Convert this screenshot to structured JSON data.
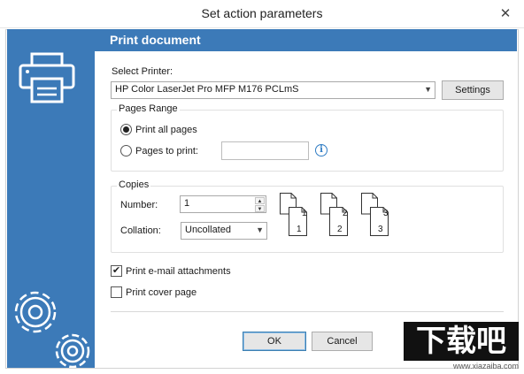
{
  "window": {
    "title": "Set action parameters",
    "close_glyph": "✕"
  },
  "header": {
    "title": "Print document"
  },
  "printer": {
    "label": "Select Printer:",
    "selected": "HP Color LaserJet Pro MFP M176 PCLmS",
    "settings_label": "Settings"
  },
  "pages_range": {
    "legend": "Pages Range",
    "print_all_label": "Print all pages",
    "print_all_selected": true,
    "pages_to_print_label": "Pages to print:",
    "pages_value": ""
  },
  "copies": {
    "legend": "Copies",
    "number_label": "Number:",
    "number_value": "1",
    "collation_label": "Collation:",
    "collation_value": "Uncollated",
    "preview_pages": [
      {
        "top": "1",
        "bottom": "1"
      },
      {
        "top": "2",
        "bottom": "2"
      },
      {
        "top": "3",
        "bottom": "3"
      }
    ]
  },
  "options": {
    "email_attachments_label": "Print e-mail attachments",
    "email_attachments_checked": true,
    "cover_page_label": "Print cover page",
    "cover_page_checked": false
  },
  "buttons": {
    "ok": "OK",
    "cancel": "Cancel"
  },
  "watermark": {
    "text": "下载吧",
    "url": "www.xiazaiba.com"
  },
  "colors": {
    "sidebar": "#3c7ab8",
    "accent": "#2f7cc4"
  },
  "icons": {
    "close": "close-icon",
    "printer": "printer-icon",
    "gears": "gears-icon",
    "info": "info-icon",
    "dropdown": "chevron-down-icon"
  }
}
